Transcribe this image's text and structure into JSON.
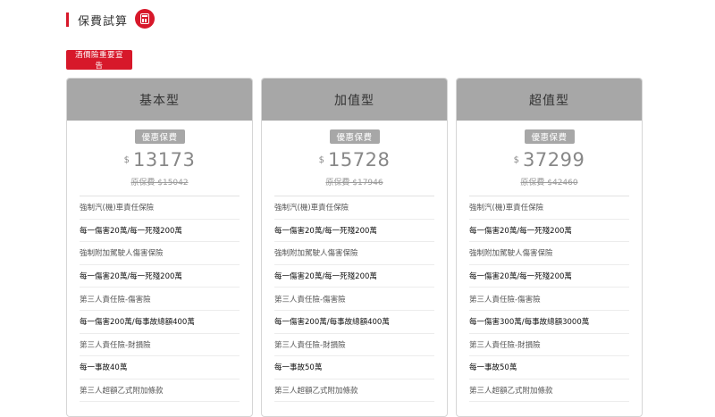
{
  "header": {
    "title": "保費試算",
    "icon": "calculator-icon",
    "accent": "#d7182a"
  },
  "warning_button": {
    "label": "酒價險重要宣告"
  },
  "plans": [
    {
      "name": "基本型",
      "badge": "優惠保費",
      "currency": "$",
      "price": "13173",
      "original": "原保費 $15042",
      "items": [
        {
          "kind": "label",
          "text": "強制汽(機)車責任保險"
        },
        {
          "kind": "value",
          "text": "每一傷害20萬/每一死殘200萬"
        },
        {
          "kind": "label",
          "text": "強制附加駕駛人傷害保險"
        },
        {
          "kind": "value",
          "text": "每一傷害20萬/每一死殘200萬"
        },
        {
          "kind": "label",
          "text": "第三人責任險-傷害險"
        },
        {
          "kind": "value",
          "text": "每一傷害200萬/每事故總額400萬"
        },
        {
          "kind": "label",
          "text": "第三人責任險-財損險"
        },
        {
          "kind": "value",
          "text": "每一事故40萬"
        },
        {
          "kind": "label",
          "text": "第三人超額乙式附加條款"
        }
      ]
    },
    {
      "name": "加值型",
      "badge": "優惠保費",
      "currency": "$",
      "price": "15728",
      "original": "原保費 $17946",
      "items": [
        {
          "kind": "label",
          "text": "強制汽(機)車責任保險"
        },
        {
          "kind": "value",
          "text": "每一傷害20萬/每一死殘200萬"
        },
        {
          "kind": "label",
          "text": "強制附加駕駛人傷害保險"
        },
        {
          "kind": "value",
          "text": "每一傷害20萬/每一死殘200萬"
        },
        {
          "kind": "label",
          "text": "第三人責任險-傷害險"
        },
        {
          "kind": "value",
          "text": "每一傷害200萬/每事故總額400萬"
        },
        {
          "kind": "label",
          "text": "第三人責任險-財損險"
        },
        {
          "kind": "value",
          "text": "每一事故50萬"
        },
        {
          "kind": "label",
          "text": "第三人超額乙式附加條款"
        }
      ]
    },
    {
      "name": "超值型",
      "badge": "優惠保費",
      "currency": "$",
      "price": "37299",
      "original": "原保費 $42460",
      "items": [
        {
          "kind": "label",
          "text": "強制汽(機)車責任保險"
        },
        {
          "kind": "value",
          "text": "每一傷害20萬/每一死殘200萬"
        },
        {
          "kind": "label",
          "text": "強制附加駕駛人傷害保險"
        },
        {
          "kind": "value",
          "text": "每一傷害20萬/每一死殘200萬"
        },
        {
          "kind": "label",
          "text": "第三人責任險-傷害險"
        },
        {
          "kind": "value",
          "text": "每一傷害300萬/每事故總額3000萬"
        },
        {
          "kind": "label",
          "text": "第三人責任險-財損險"
        },
        {
          "kind": "value",
          "text": "每一事故50萬"
        },
        {
          "kind": "label",
          "text": "第三人超額乙式附加條款"
        }
      ]
    }
  ]
}
